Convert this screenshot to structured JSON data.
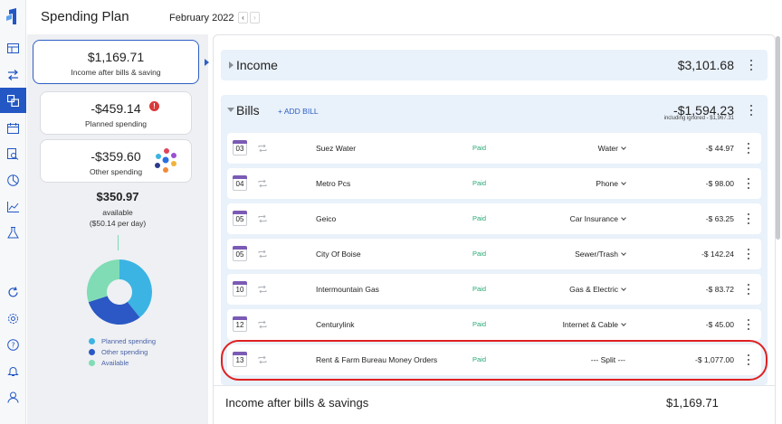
{
  "header": {
    "title": "Spending Plan",
    "month": "February 2022"
  },
  "summary": {
    "income_after": {
      "amount": "$1,169.71",
      "label": "Income after bills & saving"
    },
    "planned": {
      "amount": "-$459.14",
      "label": "Planned spending"
    },
    "other": {
      "amount": "-$359.60",
      "label": "Other spending"
    },
    "available_amount": "$350.97",
    "available_label": "available",
    "available_per_day": "($50.14 per day)",
    "legend": [
      {
        "label": "Planned spending",
        "color": "#3bb4e3"
      },
      {
        "label": "Other spending",
        "color": "#2b58c4"
      },
      {
        "label": "Available",
        "color": "#7fdcb4"
      }
    ]
  },
  "income": {
    "title": "Income",
    "amount": "$3,101.68"
  },
  "bills": {
    "title": "Bills",
    "add_label": "+ ADD BILL",
    "amount": "-$1,594.23",
    "subtext": "including ignored - $1,967.31",
    "items": [
      {
        "day": "03",
        "name": "Suez Water",
        "status": "Paid",
        "category": "Water",
        "amount": "-$ 44.97"
      },
      {
        "day": "04",
        "name": "Metro Pcs",
        "status": "Paid",
        "category": "Phone",
        "amount": "-$ 98.00"
      },
      {
        "day": "05",
        "name": "Geico",
        "status": "Paid",
        "category": "Car Insurance",
        "amount": "-$ 63.25"
      },
      {
        "day": "05",
        "name": "City Of Boise",
        "status": "Paid",
        "category": "Sewer/Trash",
        "amount": "-$ 142.24"
      },
      {
        "day": "10",
        "name": "Intermountain Gas",
        "status": "Paid",
        "category": "Gas & Electric",
        "amount": "-$ 83.72"
      },
      {
        "day": "12",
        "name": "Centurylink",
        "status": "Paid",
        "category": "Internet & Cable",
        "amount": "-$ 45.00"
      },
      {
        "day": "13",
        "name": "Rent & Farm Bureau Money Orders",
        "status": "Paid",
        "category": "--- Split ---",
        "amount": "-$ 1,077.00"
      }
    ]
  },
  "footer": {
    "label": "Income after bills & savings",
    "amount": "$1,169.71"
  },
  "colors": {
    "accent": "#2d5fc4",
    "paid": "#2aa876",
    "warning": "#d93a3a",
    "calendar": "#7b5bb5",
    "highlight": "#e02020"
  },
  "chart_data": {
    "type": "pie",
    "categories": [
      "Planned spending",
      "Other spending",
      "Available"
    ],
    "values": [
      459.14,
      359.6,
      350.97
    ],
    "legend": "bottom"
  }
}
